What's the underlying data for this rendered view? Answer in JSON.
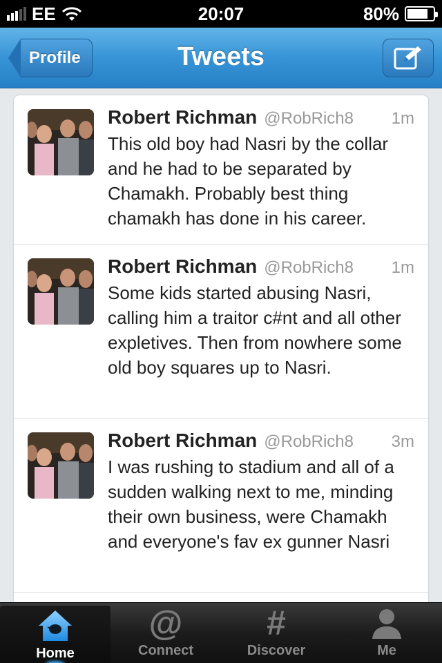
{
  "status_bar": {
    "carrier": "EE",
    "time": "20:07",
    "battery": "80%",
    "battery_level": 0.8
  },
  "nav": {
    "title": "Tweets",
    "back_label": "Profile",
    "compose_icon": "compose-icon"
  },
  "tweets": [
    {
      "name": "Robert Richman",
      "handle": "@RobRich8",
      "time": "1m",
      "text": "This old boy had Nasri by the collar and he had to be separated by Chamakh. Probably best thing chamakh has done in his career."
    },
    {
      "name": "Robert Richman",
      "handle": "@RobRich8",
      "time": "1m",
      "text": "Some kids started abusing Nasri, calling him a traitor c#nt and all other expletives. Then from nowhere some old boy squares up to Nasri."
    },
    {
      "name": "Robert Richman",
      "handle": "@RobRich8",
      "time": "3m",
      "text": "I was rushing to stadium and all of a sudden walking next to me, minding their own business, were Chamakh and everyone's fav ex gunner Nasri"
    }
  ],
  "tabs": [
    {
      "label": "Home",
      "icon": "home-icon",
      "active": true
    },
    {
      "label": "Connect",
      "icon": "at-icon",
      "active": false
    },
    {
      "label": "Discover",
      "icon": "hash-icon",
      "active": false
    },
    {
      "label": "Me",
      "icon": "person-icon",
      "active": false
    }
  ],
  "colors": {
    "nav_blue": "#3794d6",
    "active_glow": "#3fa9f5"
  }
}
